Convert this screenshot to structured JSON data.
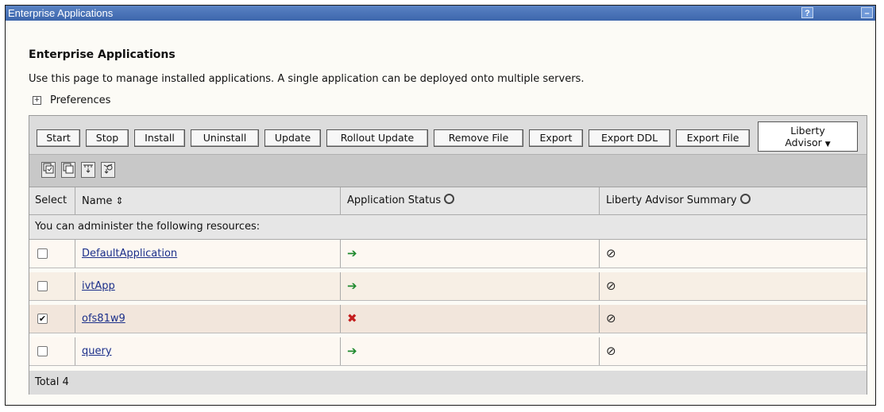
{
  "window": {
    "title": "Enterprise Applications",
    "help_label": "?",
    "minimize_label": "–"
  },
  "page": {
    "title": "Enterprise Applications",
    "description": "Use this page to manage installed applications. A single application can be deployed onto multiple servers.",
    "preferences_label": "Preferences",
    "preferences_icon": "plus-box-icon"
  },
  "toolbar": {
    "buttons": [
      "Start",
      "Stop",
      "Install",
      "Uninstall",
      "Update",
      "Rollout Update",
      "Remove File",
      "Export",
      "Export DDL",
      "Export File"
    ],
    "liberty_line1": "Liberty",
    "liberty_line2": "Advisor",
    "liberty_caret": "▼"
  },
  "iconbar": {
    "icons": [
      "select-all-icon",
      "deselect-all-icon",
      "show-filter-icon",
      "clear-filter-icon"
    ]
  },
  "table": {
    "headers": {
      "select": "Select",
      "name": "Name",
      "status": "Application Status",
      "liberty": "Liberty Advisor Summary"
    },
    "subheader": "You can administer the following resources:",
    "rows": [
      {
        "name": "DefaultApplication",
        "checked": false,
        "status": "started",
        "status_glyph": "➔",
        "liberty_glyph": "⊘"
      },
      {
        "name": "ivtApp",
        "checked": false,
        "status": "started",
        "status_glyph": "➔",
        "liberty_glyph": "⊘"
      },
      {
        "name": "ofs81w9",
        "checked": true,
        "status": "stopped",
        "status_glyph": "✖",
        "liberty_glyph": "⊘"
      },
      {
        "name": "query",
        "checked": false,
        "status": "started",
        "status_glyph": "➔",
        "liberty_glyph": "⊘"
      }
    ],
    "total": "Total 4"
  },
  "colors": {
    "title_bar": "#3d66ac",
    "started": "#1f8a2e",
    "stopped": "#c41e1e",
    "link": "#1b2f8a"
  }
}
